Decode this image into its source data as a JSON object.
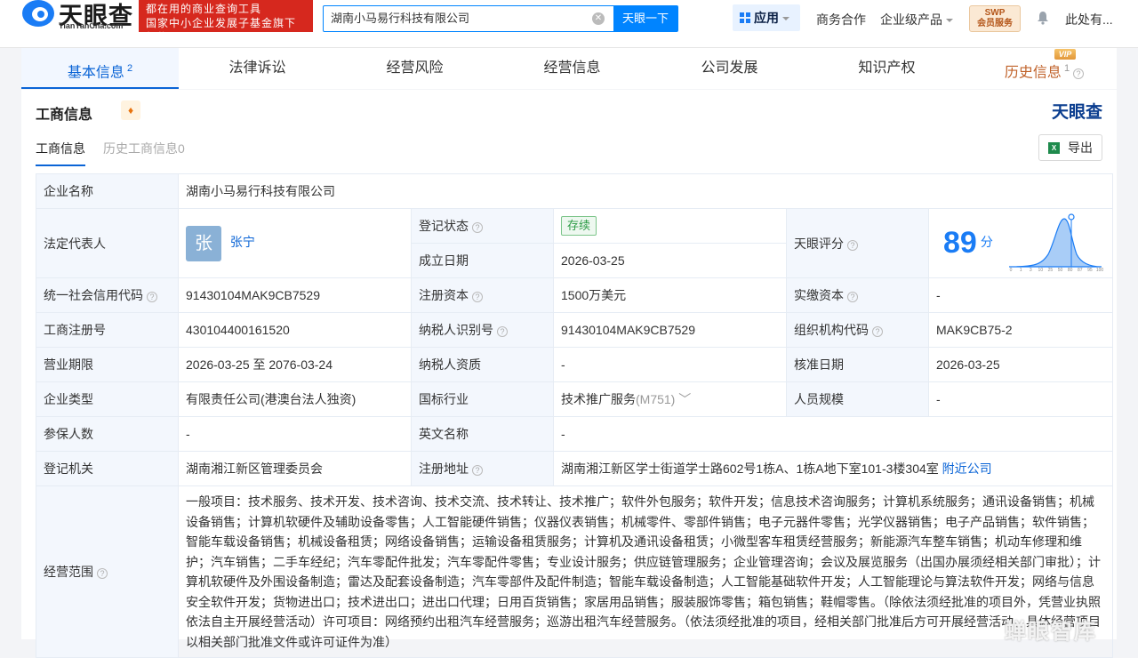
{
  "header": {
    "logo_text": "天眼查",
    "logo_sub": "TianYanCha.com",
    "slogan_line1": "都在用的商业查询工具",
    "slogan_line2": "国家中小企业发展子基金旗下机构",
    "search_value": "湖南小马易行科技有限公司",
    "search_button": "天眼一下",
    "apps_label": "应用",
    "nav_business": "商务合作",
    "nav_enterprise": "企业级产品",
    "swp_line1": "SWP",
    "swp_line2": "会员服务",
    "user_label": "此处有..."
  },
  "tabs": [
    {
      "label": "基本信息",
      "count": "2"
    },
    {
      "label": "法律诉讼"
    },
    {
      "label": "经营风险"
    },
    {
      "label": "经营信息"
    },
    {
      "label": "公司发展"
    },
    {
      "label": "知识产权"
    },
    {
      "label": "历史信息",
      "count": "1"
    }
  ],
  "vip_badge": "VIP",
  "section": {
    "title": "工商信息",
    "brand": "天眼查",
    "subtab_active": "工商信息",
    "subtab_history": "历史工商信息0",
    "export_label": "导出"
  },
  "info": {
    "company_name_label": "企业名称",
    "company_name": "湖南小马易行科技有限公司",
    "legal_rep_label": "法定代表人",
    "legal_rep_avatar": "张",
    "legal_rep": "张宁",
    "reg_status_label": "登记状态",
    "reg_status": "存续",
    "found_date_label": "成立日期",
    "found_date": "2026-03-25",
    "score_label": "天眼评分",
    "score": "89",
    "score_unit": "分",
    "credit_code_label": "统一社会信用代码",
    "credit_code": "91430104MAK9CB7529",
    "reg_capital_label": "注册资本",
    "reg_capital": "1500万美元",
    "paid_capital_label": "实缴资本",
    "paid_capital": "-",
    "reg_no_label": "工商注册号",
    "reg_no": "430104400161520",
    "taxpayer_id_label": "纳税人识别号",
    "taxpayer_id": "91430104MAK9CB7529",
    "org_code_label": "组织机构代码",
    "org_code": "MAK9CB75-2",
    "term_label": "营业期限",
    "term": "2026-03-25 至 2076-03-24",
    "taxpayer_qual_label": "纳税人资质",
    "taxpayer_qual": "-",
    "approve_date_label": "核准日期",
    "approve_date": "2026-03-25",
    "type_label": "企业类型",
    "type": "有限责任公司(港澳台法人独资)",
    "industry_label": "国标行业",
    "industry": "技术推广服务",
    "industry_code": "(M751)",
    "staff_label": "人员规模",
    "staff": "-",
    "insured_label": "参保人数",
    "insured": "-",
    "english_label": "英文名称",
    "english": "-",
    "authority_label": "登记机关",
    "authority": "湖南湘江新区管理委员会",
    "address_label": "注册地址",
    "address": "湖南湘江新区学士街道学士路602号1栋A、1栋A地下室101-3楼304室",
    "nearby": "附近公司",
    "scope_label": "经营范围",
    "scope": "一般项目：技术服务、技术开发、技术咨询、技术交流、技术转让、技术推广；软件外包服务；软件开发；信息技术咨询服务；计算机系统服务；通讯设备销售；机械设备销售；计算机软硬件及辅助设备零售；人工智能硬件销售；仪器仪表销售；机械零件、零部件销售；电子元器件零售；光学仪器销售；电子产品销售；软件销售；智能车载设备销售；机械设备租赁；网络设备销售；运输设备租赁服务；计算机及通讯设备租赁；小微型客车租赁经营服务；新能源汽车整车销售；机动车修理和维护；汽车销售；二手车经纪；汽车零配件批发；汽车零配件零售；专业设计服务；供应链管理服务；企业管理咨询；会议及展览服务（出国办展须经相关部门审批）；计算机软硬件及外围设备制造；雷达及配套设备制造；汽车零部件及配件制造；智能车载设备制造；人工智能基础软件开发；人工智能理论与算法软件开发；网络与信息安全软件开发；货物进出口；技术进出口；进出口代理；日用百货销售；家居用品销售；服装服饰零售；箱包销售；鞋帽零售。（除依法须经批准的项目外，凭营业执照依法自主开展经营活动）许可项目：网络预约出租汽车经营服务；巡游出租汽车经营服务。（依法须经批准的项目，经相关部门批准后方可开展经营活动，具体经营项目以相关部门批准文件或许可证件为准）"
  },
  "score_chart": {
    "x_ticks": [
      "0",
      "1",
      "3",
      "10",
      "25",
      "50",
      "80",
      "87",
      "95",
      "100"
    ]
  },
  "watermark": "蝉眼智库",
  "colors": {
    "accent": "#0a64d6",
    "brand_red": "#d6281e",
    "status_green": "#2b9b45"
  }
}
